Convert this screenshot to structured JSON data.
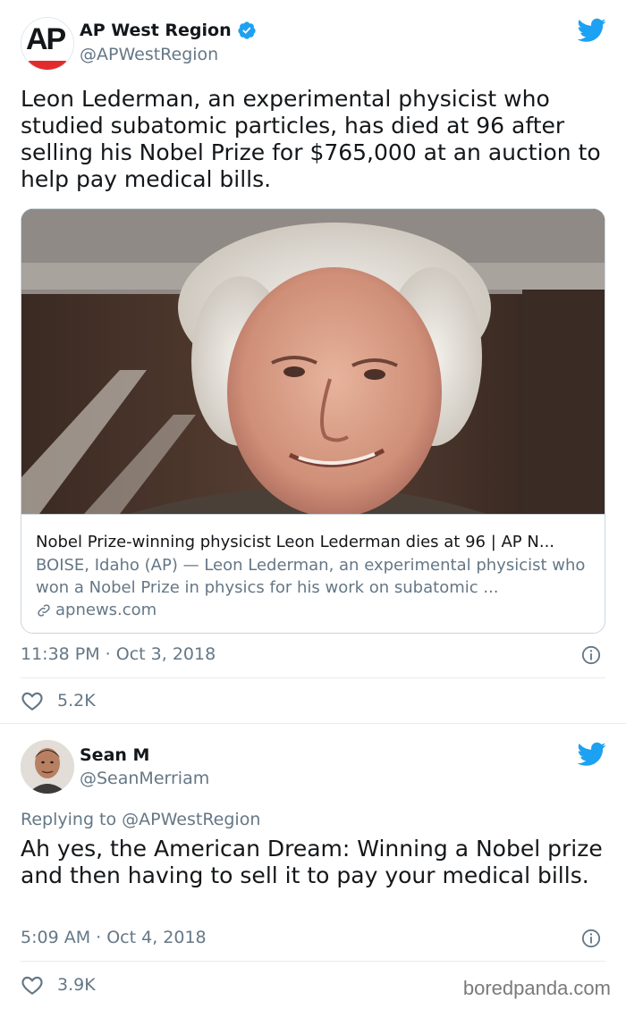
{
  "tweets": [
    {
      "author_name": "AP West Region",
      "author_handle": "@APWestRegion",
      "avatar_text": "AP",
      "text": "Leon Lederman, an experimental physicist who studied subatomic particles, has died at 96 after selling his Nobel Prize for $765,000 at an auction to help pay medical bills.",
      "card": {
        "title": "Nobel Prize-winning physicist Leon Lederman dies at 96 | AP N...",
        "description": "BOISE, Idaho (AP) — Leon Lederman, an experimental physicist who won a Nobel Prize in physics for his work on subatomic ...",
        "domain": "apnews.com"
      },
      "timestamp": "11:38 PM · Oct 3, 2018",
      "likes": "5.2K"
    },
    {
      "author_name": "Sean M",
      "author_handle": "@SeanMerriam",
      "replying_label": "Replying to",
      "replying_handle": "@APWestRegion",
      "text": "Ah yes, the American Dream: Winning a Nobel prize and then having to sell it to pay your medical bills.",
      "timestamp": "5:09 AM · Oct 4, 2018",
      "likes": "3.9K"
    }
  ],
  "watermark": "boredpanda.com",
  "colors": {
    "twitter_blue": "#1da1f2",
    "secondary_text": "#657786",
    "ap_red": "#e22c2c"
  }
}
